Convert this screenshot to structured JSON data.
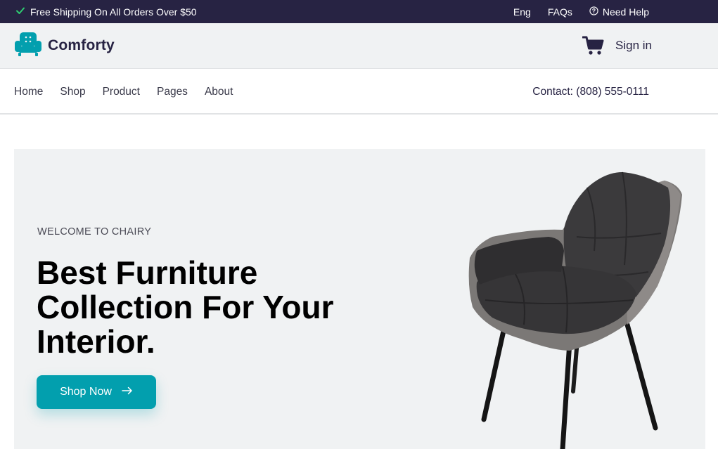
{
  "topbar": {
    "shipping_text": "Free Shipping On All Orders Over $50",
    "lang": "Eng",
    "faqs": "FAQs",
    "help": "Need Help"
  },
  "header": {
    "brand": "Comforty",
    "signin": "Sign in"
  },
  "nav": {
    "items": [
      "Home",
      "Shop",
      "Product",
      "Pages",
      "About"
    ],
    "contact": "Contact: (808) 555-0111"
  },
  "hero": {
    "welcome": "WELCOME TO CHAIRY",
    "headline": "Best Furniture Collection For Your Interior.",
    "cta": "Shop Now"
  },
  "colors": {
    "topbar_bg": "#272343",
    "accent": "#029fae",
    "header_bg": "#f0f2f3"
  },
  "icons": [
    "check-icon",
    "help-circle-icon",
    "sofa-logo-icon",
    "cart-icon",
    "arrow-right-icon"
  ]
}
